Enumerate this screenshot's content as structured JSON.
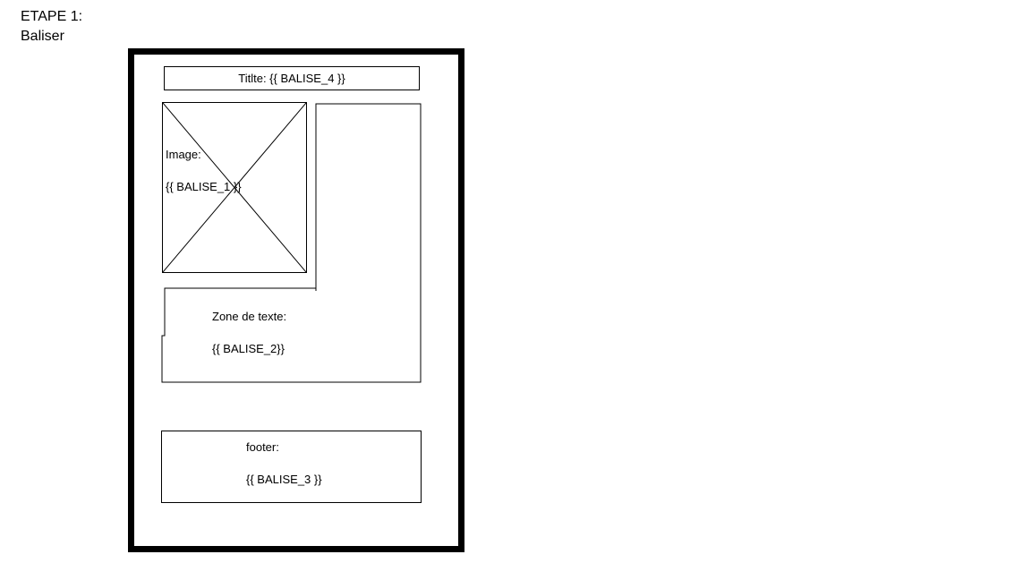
{
  "heading": {
    "step": "ETAPE 1:",
    "action": "Baliser"
  },
  "layout_mockup": {
    "title_box": {
      "text": "Titlte: {{ BALISE_4 }}"
    },
    "image_box": {
      "label": "Image:",
      "tag": "{{ BALISE_1 }}",
      "placeholder_icon": "image-placeholder-cross-icon"
    },
    "text_zone": {
      "label": "Zone de texte:",
      "tag": "{{ BALISE_2}}"
    },
    "footer_box": {
      "label": "footer:",
      "tag": "{{ BALISE_3 }}"
    }
  },
  "colors": {
    "line": "#000000",
    "background": "#ffffff"
  }
}
